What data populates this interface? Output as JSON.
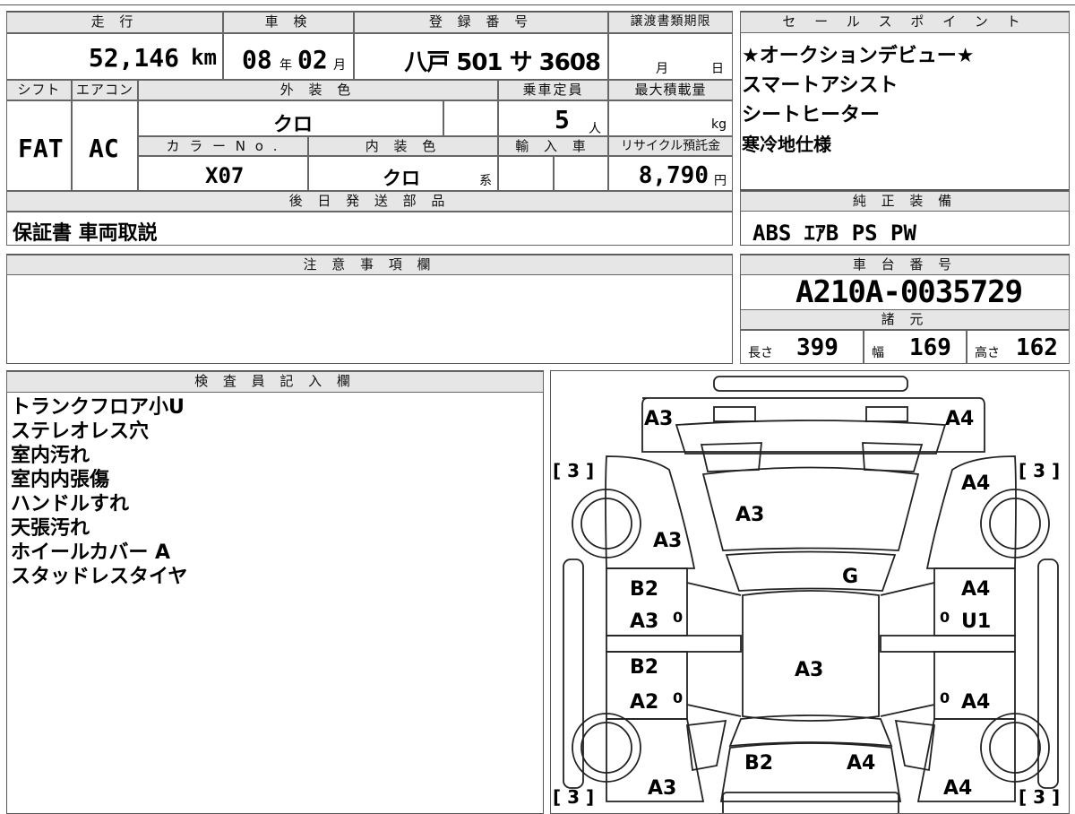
{
  "top": {
    "mileage_header": "走 行",
    "mileage_value": "52,146",
    "mileage_unit": "km",
    "shaken_header": "車 検",
    "shaken_year": "08",
    "shaken_year_unit": "年",
    "shaken_month": "02",
    "shaken_month_unit": "月",
    "reg_header": "登 録 番 号",
    "reg_value": "八戸 501 サ 3608",
    "transfer_header": "譲渡書類期限",
    "transfer_month": "月",
    "transfer_day": "日",
    "shift_header": "シフト",
    "shift_value": "FAT",
    "ac_header": "エアコン",
    "ac_value": "AC",
    "exterior_header": "外 装 色",
    "exterior_value": "クロ",
    "capacity_header": "乗車定員",
    "capacity_value": "5",
    "capacity_unit": "人",
    "load_header": "最大積載量",
    "load_unit": "kg",
    "color_no_header": "カ ラ ー N o .",
    "color_no_value": "X07",
    "interior_header": "内 装 色",
    "interior_value": "クロ",
    "interior_suffix": "系",
    "import_header": "輸 入 車",
    "recycle_header": "リサイクル預託金",
    "recycle_value": "8,790",
    "recycle_unit": "円",
    "later_header": "後 日 発 送 部 品",
    "later_value": "保証書 車両取説"
  },
  "sales": {
    "header": "セ ー ル ス ポ イ ン ト",
    "items": [
      "★オークションデビュー★",
      "スマートアシスト",
      "シートヒーター",
      "寒冷地仕様"
    ]
  },
  "equipment": {
    "header": "純 正 装 備",
    "value": "ABS ｴｱB PS PW"
  },
  "notes": {
    "header": "注 意 事 項 欄"
  },
  "chassis": {
    "header": "車 台 番 号",
    "value": "A210A-0035729",
    "spec_header": "諸 元",
    "length_label": "長さ",
    "length_value": "399",
    "width_label": "幅",
    "width_value": "169",
    "height_label": "高さ",
    "height_value": "162"
  },
  "inspector": {
    "header": "検 査 員 記 入 欄",
    "items": [
      "トランクフロア小U",
      "ステレオレス穴",
      "室内汚れ",
      "室内内張傷",
      "ハンドルすれ",
      "天張汚れ",
      "ホイールカバー A",
      "スタッドレスタイヤ"
    ]
  },
  "diagram": {
    "marks": {
      "rear_left": "A3",
      "rear_right": "A4",
      "rear_right_quarter": "A4",
      "trunk": "A3",
      "left_quarter": "A3",
      "roof_glass": "G",
      "rear_left_door_1": "B2",
      "rear_left_door_2": "A3",
      "rear_right_door_1": "A4",
      "rear_right_door_2": "U1",
      "roof": "A3",
      "front_left_door_1": "B2",
      "front_left_door_2": "A2",
      "front_right_door": "A4",
      "hood_left": "B2",
      "hood_right": "A4",
      "front_left": "A3",
      "front_right": "A4",
      "tire_rl": "[ 3 ]",
      "tire_rr": "[ 3 ]",
      "tire_fl": "[ 3 ]",
      "tire_fr": "[ 3 ]",
      "zero_1": "0",
      "zero_2": "0",
      "zero_3": "0",
      "zero_4": "0"
    }
  }
}
